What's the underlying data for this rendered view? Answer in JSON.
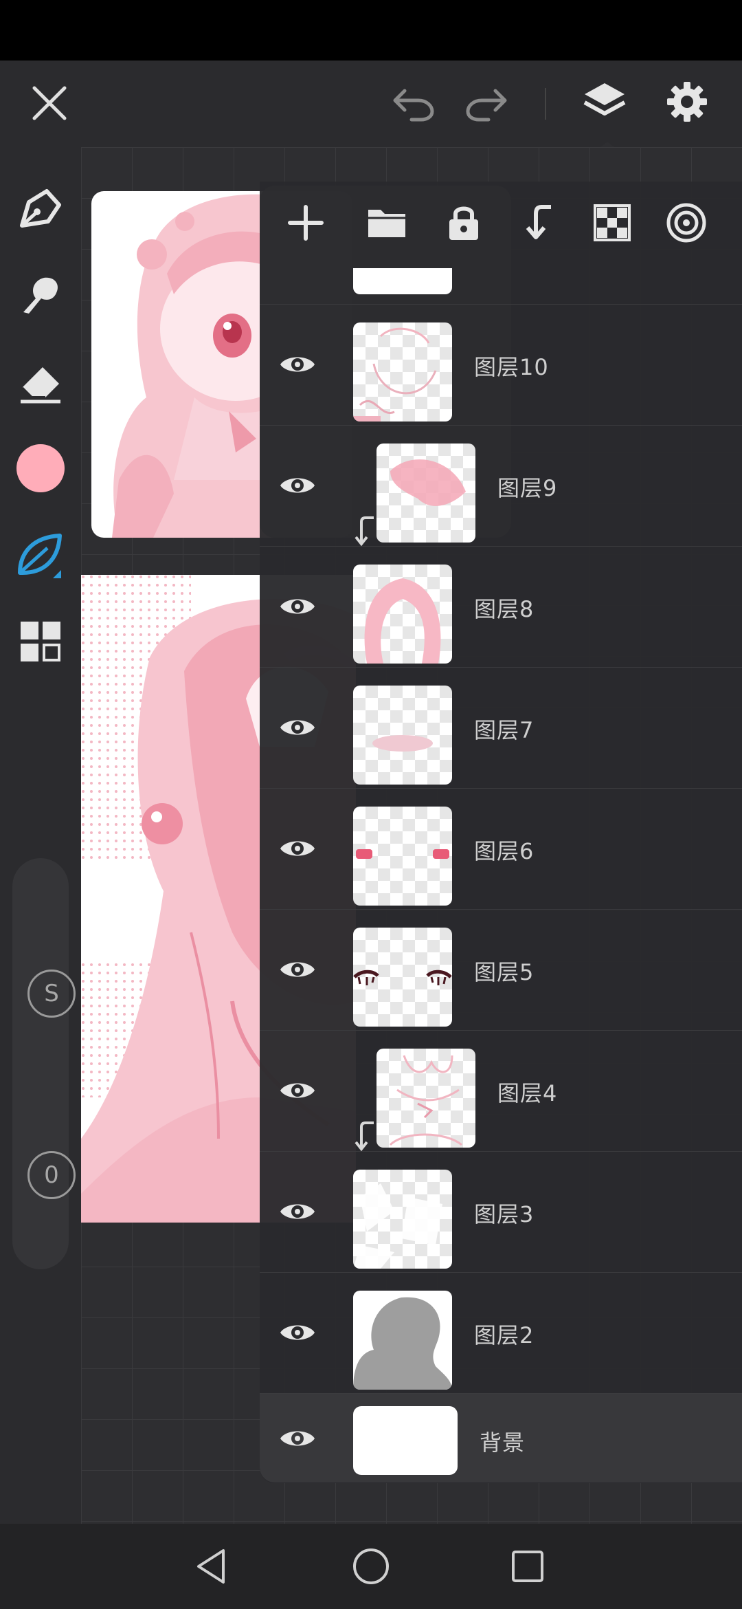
{
  "colors": {
    "accent": "#2d9cdb",
    "current_color": "#ffadb9",
    "panel": "#2a2a2d"
  },
  "top_toolbar": {
    "icons": [
      "close-icon",
      "undo-icon",
      "redo-icon",
      "layers-icon",
      "settings-icon"
    ]
  },
  "left_toolbar": {
    "tools": [
      "pen-icon",
      "smudge-icon",
      "eraser-icon",
      "color-swatch",
      "brush-leaf-icon",
      "gallery-icon"
    ],
    "size_label": "S",
    "opacity_label": "0"
  },
  "layers_panel": {
    "actions": [
      "add-layer-icon",
      "folder-icon",
      "lock-icon",
      "clip-icon",
      "alpha-lock-icon",
      "blend-icon"
    ],
    "layers": [
      {
        "name": "图层10",
        "visible": true,
        "clipped": false
      },
      {
        "name": "图层9",
        "visible": true,
        "clipped": true
      },
      {
        "name": "图层8",
        "visible": true,
        "clipped": false
      },
      {
        "name": "图层7",
        "visible": true,
        "clipped": false
      },
      {
        "name": "图层6",
        "visible": true,
        "clipped": false
      },
      {
        "name": "图层5",
        "visible": true,
        "clipped": false
      },
      {
        "name": "图层4",
        "visible": true,
        "clipped": true
      },
      {
        "name": "图层3",
        "visible": true,
        "clipped": false
      },
      {
        "name": "图层2",
        "visible": true,
        "clipped": false
      },
      {
        "name": "背景",
        "visible": true,
        "clipped": false,
        "selected": true
      }
    ]
  },
  "navbar": {
    "icons": [
      "back-icon",
      "home-icon",
      "recents-icon"
    ]
  }
}
